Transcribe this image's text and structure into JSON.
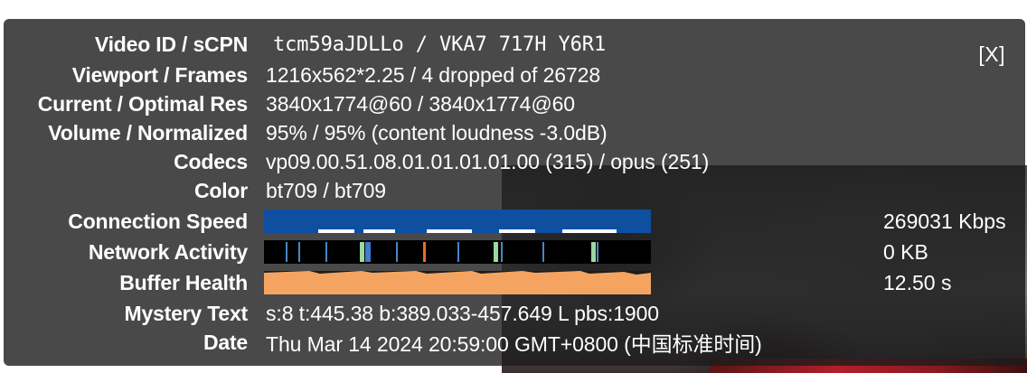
{
  "panel": {
    "close_label": "[X]",
    "rows": [
      {
        "label": "Video ID / sCPN",
        "value": "tcm59aJDLLo / VKA7 717H Y6R1"
      },
      {
        "label": "Viewport / Frames",
        "value": "1216x562*2.25 / 4 dropped of 26728"
      },
      {
        "label": "Current / Optimal Res",
        "value": "3840x1774@60 / 3840x1774@60"
      },
      {
        "label": "Volume / Normalized",
        "value": "95% / 95% (content loudness -3.0dB)"
      },
      {
        "label": "Codecs",
        "value": "vp09.00.51.08.01.01.01.01.00 (315) / opus (251)"
      },
      {
        "label": "Color",
        "value": "bt709 / bt709"
      },
      {
        "label": "Connection Speed",
        "readout": "269031 Kbps"
      },
      {
        "label": "Network Activity",
        "readout": "0 KB"
      },
      {
        "label": "Buffer Health",
        "readout": "12.50 s"
      },
      {
        "label": "Mystery Text",
        "value": "s:8 t:445.38 b:389.033-457.649 L pbs:1900"
      },
      {
        "label": "Date",
        "value": "Thu Mar 14 2024 20:59:00 GMT+0800 (中国标准时间)"
      }
    ]
  },
  "colors": {
    "connection_speed": "#0f4fa0",
    "network_activity_bg": "#000000",
    "network_activity_spike": "#9ad8a0",
    "network_activity_peak": "#f06a2a",
    "buffer_health": "#f4a460"
  },
  "icons": {
    "close": "close-icon"
  }
}
